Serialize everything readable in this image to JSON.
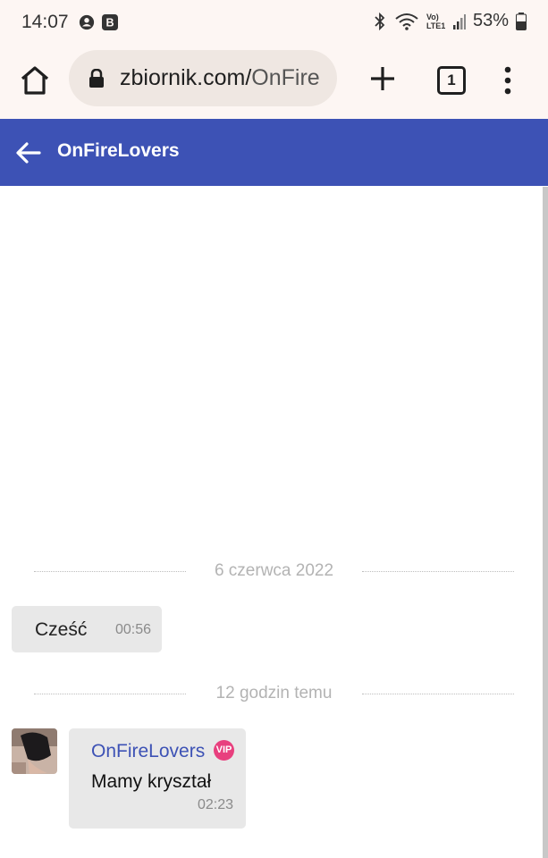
{
  "status_bar": {
    "time": "14:07",
    "left_icons": [
      "account-circle-icon",
      "b-app-icon"
    ],
    "network_label": "Vo) LTE1",
    "battery": "53%"
  },
  "browser": {
    "url_domain": "zbiornik.com/",
    "url_path": "OnFire",
    "tab_count": "1"
  },
  "header": {
    "title": "OnFireLovers"
  },
  "chat": {
    "separators": [
      "6 czerwca 2022",
      "12 godzin temu"
    ],
    "messages": [
      {
        "text": "Cześć",
        "time": "00:56"
      },
      {
        "sender": "OnFireLovers",
        "badge": "VIP",
        "text": "Mamy kryształ",
        "time": "02:23"
      }
    ]
  },
  "colors": {
    "header_bg": "#3d52b5",
    "bubble_bg": "#e8e8e8",
    "vip_badge": "#e8407e",
    "browser_bg": "#fdf6f3"
  }
}
